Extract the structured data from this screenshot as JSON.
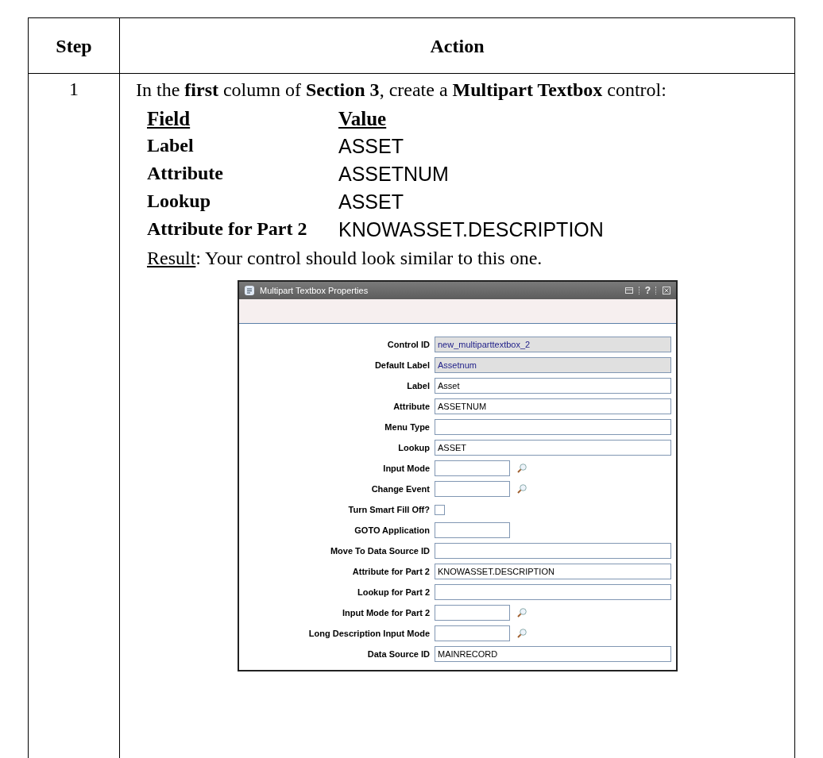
{
  "table": {
    "columns": [
      "Step",
      "Action"
    ],
    "rows": [
      {
        "step": "1",
        "instruction": "In the **first** column of **Section 3**, create a **Multipart Textbox** control:",
        "settings": {
          "headers": [
            "Field",
            "Value"
          ],
          "rows": [
            {
              "field": "Label",
              "value": "ASSET"
            },
            {
              "field": "Attribute",
              "value": "ASSETNUM"
            },
            {
              "field": "Lookup",
              "value": "ASSET"
            },
            {
              "field": "Attribute for Part 2",
              "value": "KNOWASSET.DESCRIPTION"
            }
          ]
        },
        "result_label": "Result",
        "result_text": ": Your control should look similar to this one.",
        "dialog": {
          "title": "Multipart Textbox Properties",
          "help": "?",
          "fields": [
            {
              "label": "Control ID",
              "kind": "wide",
              "value": "new_multiparttextbox_2",
              "readonly": true
            },
            {
              "label": "Default Label",
              "kind": "wide",
              "value": "Assetnum",
              "readonly": true
            },
            {
              "label": "Label",
              "kind": "wide",
              "value": "Asset",
              "readonly": false
            },
            {
              "label": "Attribute",
              "kind": "wide",
              "value": "ASSETNUM",
              "readonly": false
            },
            {
              "label": "Menu Type",
              "kind": "wide",
              "readonly": false
            },
            {
              "label": "Lookup",
              "kind": "wide",
              "value": "ASSET",
              "readonly": false
            },
            {
              "label": "Input Mode",
              "kind": "lookup",
              "readonly": false
            },
            {
              "label": "Change Event",
              "kind": "lookup",
              "readonly": false
            },
            {
              "label": "Turn Smart Fill Off?",
              "kind": "checkbox",
              "checked": false
            },
            {
              "label": "GOTO Application",
              "kind": "short",
              "readonly": false
            },
            {
              "label": "Move To Data Source ID",
              "kind": "wide",
              "readonly": false
            },
            {
              "label": "Attribute for Part 2",
              "kind": "wide",
              "value": "KNOWASSET.DESCRIPTION",
              "readonly": false
            },
            {
              "label": "Lookup for Part 2",
              "kind": "wide",
              "readonly": false
            },
            {
              "label": "Input Mode for Part 2",
              "kind": "lookup",
              "readonly": false
            },
            {
              "label": "Long Description Input Mode",
              "kind": "lookup",
              "readonly": false
            },
            {
              "label": "Data Source ID",
              "kind": "wide",
              "value": "MAINRECORD",
              "readonly": false
            }
          ]
        }
      }
    ]
  }
}
